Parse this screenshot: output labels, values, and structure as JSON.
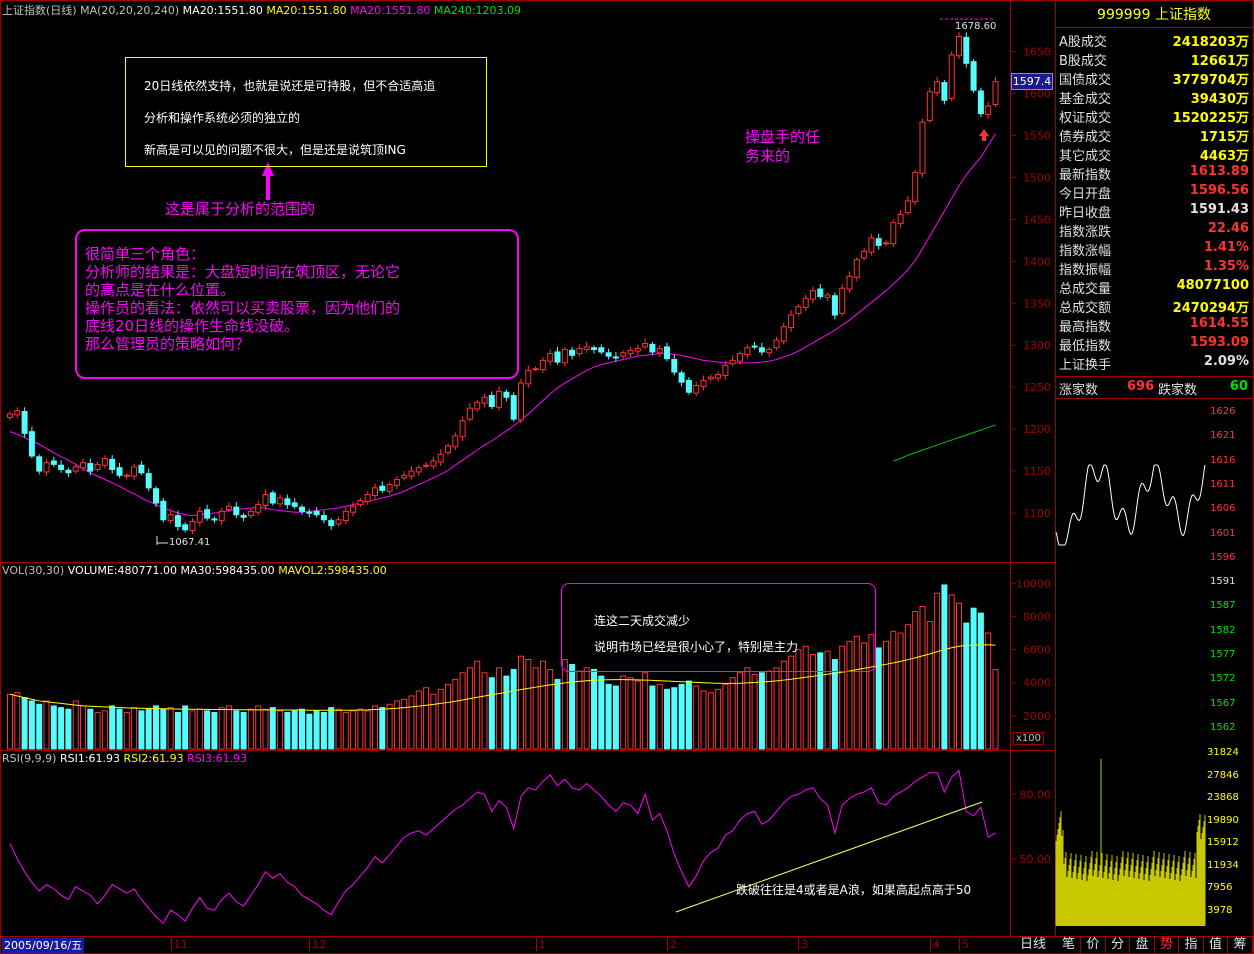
{
  "main_header": {
    "title": "上证指数(日线)",
    "ma_params": "MA(20,20,20,240)",
    "ma1": "MA20:1551.80",
    "ma2": "MA20:1551.80",
    "ma3": "MA20:1551.80",
    "ma4": "MA240:1203.09"
  },
  "vol_header": {
    "title": "VOL(30,30)",
    "volume": "VOLUME:480771.00",
    "ma30": "MA30:598435.00",
    "mavol2": "MAVOL2:598435.00"
  },
  "rsi_header": {
    "title": "RSI(9,9,9)",
    "rsi1": "RSI1:61.93",
    "rsi2": "RSI2:61.93",
    "rsi3": "RSI3:61.93"
  },
  "annotations": {
    "box1_line1": "20日线依然支持，也就是说还是可持股，但不合适高追",
    "box1_line2": "分析和操作系统必须的独立的",
    "box1_line3": "新高是可以见的问题不很大，但是还是说筑顶ING",
    "arrow_caption": "这是属于分析的范围的",
    "box2_line1": "很简单三个角色：",
    "box2_line2": "分析师的结果是：大盘短时间在筑顶区，无论它",
    "box2_line3": "的高点是在什么位置。",
    "box2_line4": "操作员的看法：依然可以买卖股票，因为他们的",
    "box2_line5": "底线20日线的操作生命线没破。",
    "box2_line6": "那么管理员的策略如何？",
    "trader_line1": "操盘手的任",
    "trader_line2": "务来的",
    "vol_box_line1": "连这二天成交减少",
    "vol_box_line2": "说明市场已经是很小心了，特别是主力",
    "rsi_note": "跌破往往是4或者是A浪，如果高起点高于50"
  },
  "price_labels": {
    "high": "1678.60",
    "low": "1067.41",
    "current": "1597.4"
  },
  "vol_unit": "x100",
  "x_axis": {
    "date": "2005/09/16/五",
    "months": [
      "11",
      "12",
      "1",
      "2",
      "3",
      "4",
      "5"
    ]
  },
  "right_panel": {
    "code": "999999",
    "name": "上证指数",
    "rows": [
      {
        "label": "A股成交",
        "value": "2418203万"
      },
      {
        "label": "B股成交",
        "value": "12661万"
      },
      {
        "label": "国债成交",
        "value": "3779704万"
      },
      {
        "label": "基金成交",
        "value": "39430万"
      },
      {
        "label": "权证成交",
        "value": "1520225万"
      },
      {
        "label": "债券成交",
        "value": "1715万"
      },
      {
        "label": "其它成交",
        "value": "4463万"
      },
      {
        "label": "最新指数",
        "value": "1613.89"
      },
      {
        "label": "今日开盘",
        "value": "1596.56"
      },
      {
        "label": "昨日收盘",
        "value": "1591.43"
      },
      {
        "label": "指数涨跌",
        "value": "22.46"
      },
      {
        "label": "指数涨幅",
        "value": "1.41%"
      },
      {
        "label": "指数振幅",
        "value": "1.35%"
      },
      {
        "label": "总成交量",
        "value": "48077100"
      },
      {
        "label": "总成交额",
        "value": "2470294万"
      },
      {
        "label": "最高指数",
        "value": "1614.55"
      },
      {
        "label": "最低指数",
        "value": "1593.09"
      },
      {
        "label": "上证换手",
        "value": "2.09%"
      }
    ],
    "up_label": "涨家数",
    "up_count": "696",
    "down_label": "跌家数",
    "down_count": "60",
    "mini_price_ticks": [
      "1626",
      "1621",
      "1616",
      "1611",
      "1606",
      "1601",
      "1596",
      "1591",
      "1587",
      "1582",
      "1577",
      "1572",
      "1567",
      "1562"
    ],
    "mini_vol_ticks": [
      "31824",
      "27846",
      "23868",
      "19890",
      "15912",
      "11934",
      "7956",
      "3978"
    ]
  },
  "bottom_tabs": {
    "period": "日线",
    "items": [
      "笔",
      "价",
      "分",
      "盘",
      "势",
      "指",
      "值",
      "筹"
    ]
  },
  "colors": {
    "up": "#ff3232",
    "down": "#54fcfc",
    "ma20": "#ff00ff",
    "ma240": "#00c000",
    "mavol": "#ffff00",
    "rsi": "#ff00ff",
    "grid": "#800000",
    "box": "#ffff00"
  },
  "chart_data": [
    {
      "type": "candlestick",
      "title": "上证指数(日线)",
      "ylim": [
        1050,
        1690
      ],
      "yticks": [
        1100,
        1150,
        1200,
        1250,
        1300,
        1350,
        1400,
        1450,
        1500,
        1550,
        1600,
        1650
      ],
      "x_month_labels": [
        "11",
        "12",
        "1",
        "2",
        "3",
        "4",
        "5"
      ],
      "close": [
        1218,
        1222,
        1195,
        1168,
        1150,
        1160,
        1158,
        1152,
        1148,
        1155,
        1160,
        1150,
        1158,
        1165,
        1152,
        1145,
        1145,
        1155,
        1148,
        1130,
        1112,
        1092,
        1098,
        1084,
        1080,
        1090,
        1102,
        1094,
        1092,
        1102,
        1108,
        1098,
        1095,
        1102,
        1110,
        1122,
        1112,
        1118,
        1110,
        1108,
        1102,
        1100,
        1098,
        1092,
        1085,
        1092,
        1102,
        1108,
        1115,
        1122,
        1130,
        1127,
        1134,
        1140,
        1145,
        1150,
        1154,
        1157,
        1162,
        1170,
        1180,
        1192,
        1210,
        1225,
        1232,
        1238,
        1227,
        1245,
        1238,
        1212,
        1255,
        1270,
        1272,
        1282,
        1290,
        1280,
        1295,
        1288,
        1296,
        1298,
        1295,
        1292,
        1287,
        1285,
        1291,
        1294,
        1296,
        1302,
        1292,
        1296,
        1284,
        1268,
        1256,
        1244,
        1252,
        1258,
        1262,
        1265,
        1276,
        1282,
        1290,
        1297,
        1298,
        1292,
        1295,
        1306,
        1322,
        1336,
        1346,
        1356,
        1365,
        1358,
        1360,
        1336,
        1368,
        1382,
        1402,
        1412,
        1428,
        1419,
        1422,
        1446,
        1456,
        1472,
        1506,
        1566,
        1602,
        1614,
        1592,
        1646,
        1668,
        1636,
        1604,
        1576,
        1585,
        1614
      ],
      "ma20": [
        1197,
        1194,
        1190,
        1186,
        1182,
        1177,
        1172,
        1167,
        1163,
        1158,
        1153,
        1148,
        1144,
        1140,
        1136,
        1132,
        1127,
        1123,
        1118,
        1114,
        1110,
        1106,
        1103,
        1100,
        1098,
        1097,
        1098,
        1099,
        1100,
        1101,
        1103,
        1104,
        1105,
        1106,
        1107,
        1106,
        1104,
        1103,
        1102,
        1101,
        1101,
        1102,
        1103,
        1104,
        1105,
        1106,
        1108,
        1110,
        1112,
        1114,
        1116,
        1118,
        1120,
        1123,
        1126,
        1130,
        1134,
        1138,
        1142,
        1146,
        1151,
        1157,
        1163,
        1169,
        1175,
        1181,
        1186,
        1192,
        1198,
        1204,
        1211,
        1218,
        1226,
        1234,
        1242,
        1249,
        1255,
        1260,
        1265,
        1270,
        1274,
        1277,
        1279,
        1281,
        1283,
        1285,
        1287,
        1288,
        1289,
        1290,
        1290,
        1289,
        1288,
        1286,
        1284,
        1282,
        1281,
        1280,
        1279,
        1279,
        1279,
        1279,
        1279,
        1280,
        1281,
        1283,
        1286,
        1289,
        1293,
        1298,
        1303,
        1308,
        1313,
        1318,
        1324,
        1330,
        1337,
        1344,
        1351,
        1358,
        1365,
        1373,
        1381,
        1390,
        1401,
        1415,
        1430,
        1445,
        1460,
        1475,
        1490,
        1503,
        1514,
        1524,
        1538,
        1552
      ],
      "ma240": [
        1162,
        1165,
        1169,
        1172,
        1175,
        1178,
        1181,
        1184,
        1187,
        1190,
        1193,
        1196,
        1199,
        1202,
        1205
      ]
    },
    {
      "type": "bar",
      "title": "VOL(30,30)",
      "ylim": [
        0,
        10500
      ],
      "yticks": [
        2000,
        4000,
        6000,
        8000,
        10000
      ],
      "unit": "x100",
      "values": [
        3300,
        3400,
        3100,
        2900,
        2700,
        2900,
        2600,
        2500,
        2400,
        2900,
        2600,
        2400,
        2200,
        2300,
        2600,
        2400,
        2200,
        2500,
        2300,
        2400,
        2600,
        2400,
        2500,
        2200,
        2600,
        2300,
        2400,
        2300,
        2200,
        2500,
        2600,
        2300,
        2200,
        2400,
        2600,
        2400,
        2500,
        2300,
        2200,
        2300,
        2400,
        2100,
        2300,
        2200,
        2500,
        2400,
        2200,
        2300,
        2400,
        2300,
        2600,
        2500,
        2700,
        2900,
        3000,
        3200,
        3500,
        3700,
        3300,
        3600,
        3900,
        4200,
        4600,
        4900,
        5300,
        4600,
        4300,
        4900,
        4400,
        4800,
        5600,
        5400,
        4900,
        5300,
        4800,
        4200,
        5400,
        5100,
        4700,
        4900,
        4800,
        4400,
        3900,
        3800,
        4400,
        4300,
        4100,
        4600,
        3800,
        3900,
        3600,
        3700,
        3900,
        4100,
        3800,
        3500,
        3400,
        3600,
        3900,
        4300,
        4600,
        4900,
        4500,
        4600,
        4700,
        4900,
        5300,
        5600,
        6000,
        6200,
        5700,
        5800,
        5900,
        5400,
        6200,
        6500,
        6800,
        6400,
        6900,
        6100,
        6500,
        7100,
        7000,
        7500,
        8300,
        8600,
        7700,
        9400,
        9900,
        9300,
        8800,
        7600,
        8500,
        8200,
        7000,
        4800
      ],
      "ma30": [
        3300,
        3200,
        3100,
        3000,
        2900,
        2850,
        2800,
        2750,
        2700,
        2650,
        2600,
        2580,
        2560,
        2540,
        2520,
        2500,
        2480,
        2470,
        2460,
        2450,
        2440,
        2430,
        2420,
        2410,
        2400,
        2400,
        2400,
        2390,
        2380,
        2380,
        2380,
        2370,
        2370,
        2360,
        2360,
        2360,
        2350,
        2350,
        2350,
        2350,
        2350,
        2340,
        2340,
        2340,
        2340,
        2340,
        2340,
        2340,
        2350,
        2360,
        2380,
        2400,
        2430,
        2460,
        2500,
        2540,
        2590,
        2640,
        2690,
        2750,
        2810,
        2880,
        2960,
        3040,
        3120,
        3200,
        3280,
        3350,
        3420,
        3500,
        3580,
        3660,
        3730,
        3800,
        3870,
        3930,
        3990,
        4040,
        4080,
        4120,
        4150,
        4170,
        4180,
        4190,
        4190,
        4180,
        4170,
        4160,
        4140,
        4120,
        4100,
        4080,
        4060,
        4040,
        4020,
        4000,
        3980,
        3970,
        3960,
        3960,
        3970,
        3990,
        4010,
        4040,
        4070,
        4110,
        4160,
        4210,
        4270,
        4330,
        4390,
        4450,
        4510,
        4570,
        4640,
        4710,
        4790,
        4870,
        4950,
        5030,
        5110,
        5200,
        5290,
        5390,
        5500,
        5620,
        5740,
        5870,
        6000,
        6110,
        6200,
        6250,
        6270,
        6280,
        6280,
        6270
      ]
    },
    {
      "type": "line",
      "title": "RSI(9,9,9)",
      "ylim": [
        15,
        95
      ],
      "yticks": [
        50,
        80
      ],
      "values": [
        57,
        50,
        44,
        39,
        35,
        38,
        36,
        33,
        31,
        37,
        35,
        33,
        29,
        33,
        38,
        36,
        34,
        36,
        31,
        27,
        23,
        20,
        26,
        24,
        21,
        27,
        32,
        27,
        26,
        31,
        34,
        30,
        28,
        33,
        38,
        44,
        41,
        43,
        39,
        37,
        33,
        31,
        29,
        26,
        24,
        30,
        35,
        38,
        42,
        46,
        51,
        48,
        52,
        56,
        60,
        62,
        63,
        61,
        64,
        67,
        70,
        73,
        75,
        78,
        81,
        80,
        72,
        77,
        74,
        64,
        79,
        83,
        82,
        86,
        89,
        84,
        87,
        83,
        82,
        85,
        82,
        79,
        75,
        72,
        76,
        75,
        71,
        80,
        68,
        71,
        63,
        52,
        44,
        37,
        42,
        49,
        53,
        55,
        61,
        63,
        68,
        71,
        72,
        66,
        68,
        72,
        76,
        79,
        80,
        82,
        83,
        78,
        75,
        62,
        75,
        78,
        80,
        81,
        83,
        76,
        75,
        79,
        81,
        83,
        86,
        88,
        90,
        90,
        81,
        88,
        91,
        72,
        70,
        74,
        60,
        62
      ]
    }
  ]
}
